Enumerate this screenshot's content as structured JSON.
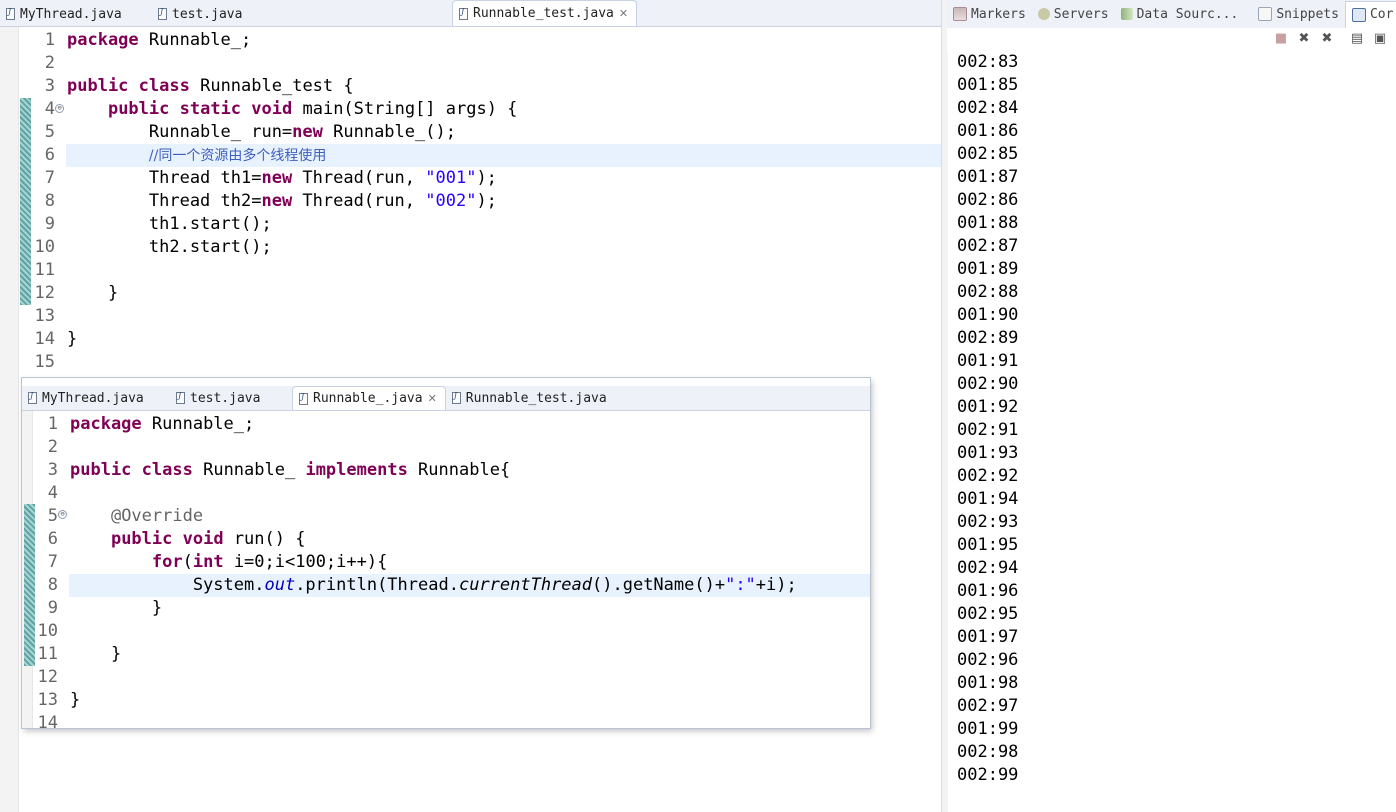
{
  "editor_top": {
    "tabs": [
      {
        "label": "MyThread.java",
        "active": false
      },
      {
        "label": "test.java",
        "active": false
      },
      {
        "label": "Runnable_test.java",
        "active": true
      }
    ],
    "line_numbers": [
      "1",
      "2",
      "3",
      "4",
      "5",
      "6",
      "7",
      "8",
      "9",
      "10",
      "11",
      "12",
      "13",
      "14",
      "15"
    ],
    "lines": [
      "package Runnable_;",
      "",
      "public class Runnable_test {",
      "    public static void main(String[] args) {",
      "        Runnable_ run=new Runnable_();",
      "        //同一个资源由多个线程使用",
      "        Thread th1=new Thread(run, \"001\");",
      "        Thread th2=new Thread(run, \"002\");",
      "        th1.start();",
      "        th2.start();",
      "",
      "    }",
      "",
      "}",
      ""
    ]
  },
  "editor_bottom": {
    "tabs": [
      {
        "label": "MyThread.java",
        "active": false
      },
      {
        "label": "test.java",
        "active": false
      },
      {
        "label": "Runnable_.java",
        "active": true
      },
      {
        "label": "Runnable_test.java",
        "active": false
      }
    ],
    "line_numbers": [
      "1",
      "2",
      "3",
      "4",
      "5",
      "6",
      "7",
      "8",
      "9",
      "10",
      "11",
      "12",
      "13",
      "14"
    ],
    "lines": [
      "package Runnable_;",
      "",
      "public class Runnable_ implements Runnable{",
      "",
      "    @Override",
      "    public void run() {",
      "        for(int i=0;i<100;i++){",
      "            System.out.println(Thread.currentThread().getName()+\":\"+i);",
      "        }",
      "",
      "    }",
      "",
      "}",
      ""
    ]
  },
  "right_panel": {
    "tabs": [
      "Markers",
      "Servers",
      "Data Sourc...",
      "Snippets",
      "Cor"
    ],
    "console_lines": [
      "002:83",
      "001:85",
      "002:84",
      "001:86",
      "002:85",
      "001:87",
      "002:86",
      "001:88",
      "002:87",
      "001:89",
      "002:88",
      "001:90",
      "002:89",
      "001:91",
      "002:90",
      "001:92",
      "002:91",
      "001:93",
      "002:92",
      "001:94",
      "002:93",
      "001:95",
      "002:94",
      "001:96",
      "002:95",
      "001:97",
      "002:96",
      "001:98",
      "002:97",
      "001:99",
      "002:98",
      "002:99"
    ]
  }
}
